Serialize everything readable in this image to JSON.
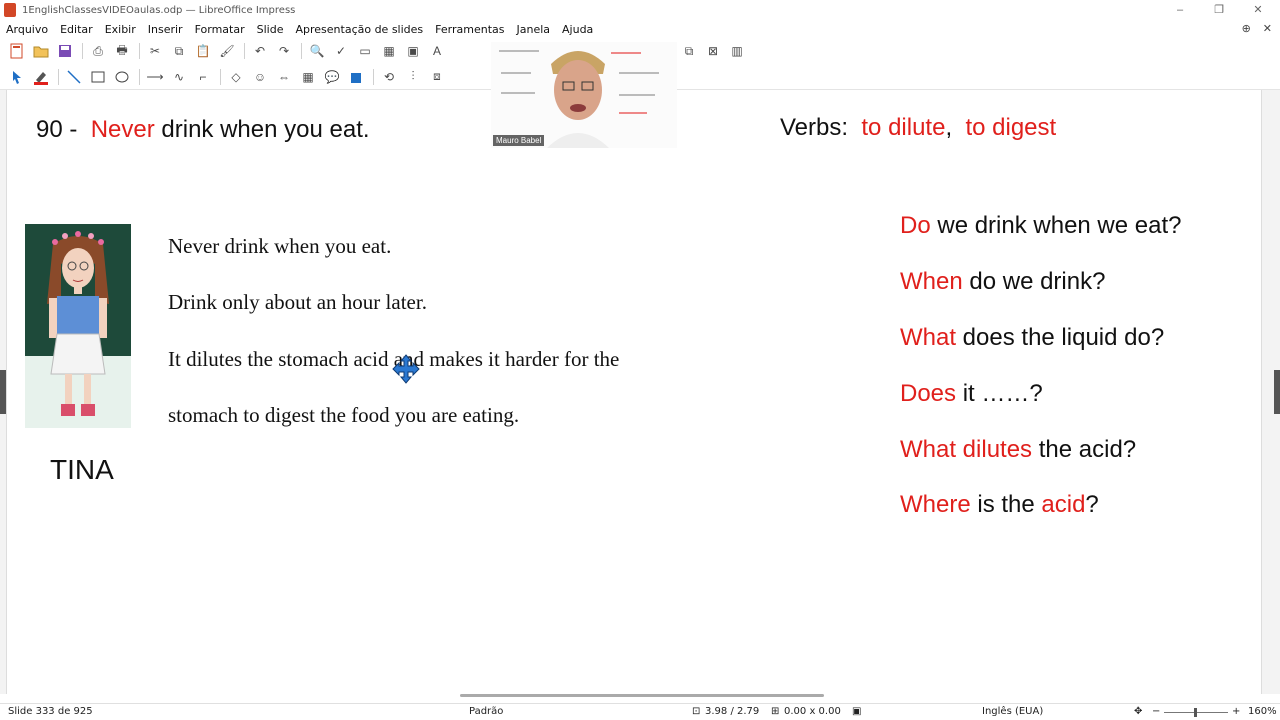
{
  "window": {
    "title": "1EnglishClassesVIDEOaulas.odp — LibreOffice Impress",
    "minimize_glyph": "–",
    "restore_glyph": "❐",
    "close_glyph": "✕"
  },
  "menu": [
    "Arquivo",
    "Editar",
    "Exibir",
    "Inserir",
    "Formatar",
    "Slide",
    "Apresentação de slides",
    "Ferramentas",
    "Janela",
    "Ajuda"
  ],
  "slide": {
    "number_prefix": "90 -",
    "title_red": "Never",
    "title_rest": "drink when you eat.",
    "verbs_label": "Verbs:",
    "verb1": "to dilute",
    "verb_sep": ",",
    "verb2": "to digest",
    "character_name": "TINA",
    "body_lines": [
      "Never drink when you eat.",
      "Drink only about an hour later.",
      "It dilutes the stomach acid and makes it harder for the",
      "stomach to digest the food you are eating."
    ],
    "questions": [
      {
        "red": "Do",
        "rest": " we drink when we eat?"
      },
      {
        "red": "When",
        "rest": " do we drink?"
      },
      {
        "red": "What",
        "rest": " does the liquid do?"
      },
      {
        "red": "Does",
        "rest": " it ……?"
      },
      {
        "red": "What dilutes",
        "rest": " the acid?"
      },
      {
        "red": "Where",
        "rest": " is the ",
        "red2": "acid",
        "tail": "?"
      }
    ]
  },
  "webcam": {
    "name": "Mauro Babel"
  },
  "status": {
    "slide_info": "Slide 333 de 925",
    "layout": "Padrão",
    "position": "3.98 / 2.79",
    "size": "0.00 x 0.00",
    "language": "Inglês (EUA)",
    "zoom": "160%"
  },
  "colors": {
    "accent_red": "#e0201c",
    "text": "#111111"
  }
}
